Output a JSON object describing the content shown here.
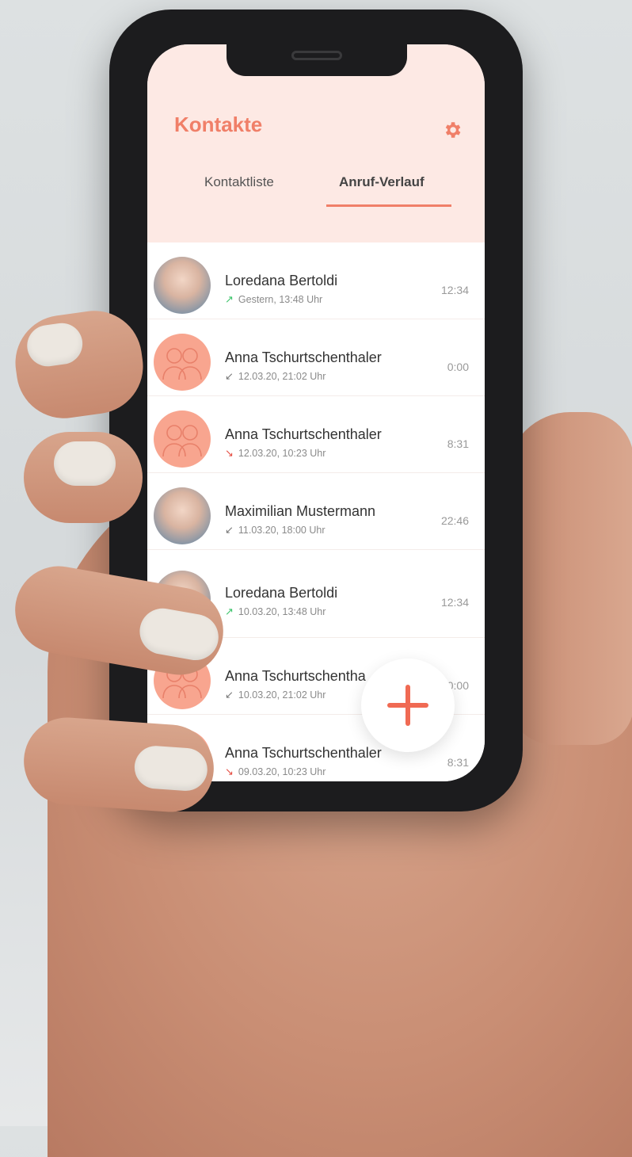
{
  "app": {
    "title": "Kontakte",
    "accent_color": "#f07f68",
    "header_bg": "#fde9e4"
  },
  "header": {
    "settings_icon": "gear-icon"
  },
  "tabs": [
    {
      "label": "Kontaktliste",
      "active": false
    },
    {
      "label": "Anruf-Verlauf",
      "active": true
    }
  ],
  "calls": [
    {
      "name": "Loredana Bertoldi",
      "direction": "outgoing",
      "time": "Gestern, 13:48 Uhr",
      "duration": "12:34",
      "avatar": "photo"
    },
    {
      "name": "Anna Tschurtschenthaler",
      "direction": "incoming",
      "time": "12.03.20, 21:02 Uhr",
      "duration": "0:00",
      "avatar": "illustration"
    },
    {
      "name": "Anna Tschurtschenthaler",
      "direction": "missed",
      "time": "12.03.20, 10:23 Uhr",
      "duration": "8:31",
      "avatar": "illustration"
    },
    {
      "name": "Maximilian Mustermann",
      "direction": "incoming",
      "time": "11.03.20, 18:00 Uhr",
      "duration": "22:46",
      "avatar": "photo"
    },
    {
      "name": "Loredana Bertoldi",
      "direction": "outgoing",
      "time": "10.03.20, 13:48 Uhr",
      "duration": "12:34",
      "avatar": "photo"
    },
    {
      "name": "Anna Tschurtschentha",
      "direction": "incoming",
      "time": "10.03.20, 21:02 Uhr",
      "duration": "0:00",
      "avatar": "illustration"
    },
    {
      "name": "Anna Tschurtschenthaler",
      "direction": "missed",
      "time": "09.03.20, 10:23 Uhr",
      "duration": "8:31",
      "avatar": "illustration"
    }
  ],
  "fab": {
    "icon": "plus-icon"
  }
}
